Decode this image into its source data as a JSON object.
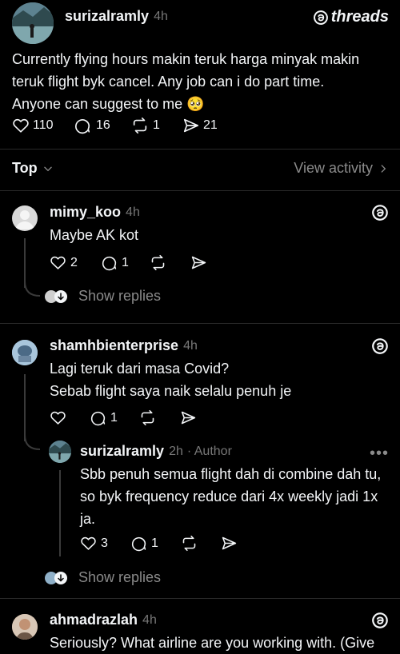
{
  "brand": {
    "name": "threads"
  },
  "post": {
    "username": "surizalramly",
    "time": "4h",
    "text_lines": [
      "Currently flying hours  makin teruk harga minyak  makin",
      "teruk flight byk cancel. Any job can i do part  time.",
      "Anyone  can suggest to me"
    ],
    "emoji": "🥺",
    "likes": "110",
    "comments": "16",
    "reposts": "1",
    "shares": "21"
  },
  "filter": {
    "sort_label": "Top",
    "view_activity": "View activity"
  },
  "replies": [
    {
      "username": "mimy_koo",
      "time": "4h",
      "text_lines": [
        "Maybe AK kot"
      ],
      "likes": "2",
      "comments": "1",
      "show_replies": "Show replies"
    },
    {
      "username": "shamhbienterprise",
      "time": "4h",
      "text_lines": [
        "Lagi teruk dari masa Covid?",
        "Sebab flight saya naik selalu penuh je"
      ],
      "likes": "",
      "comments": "1",
      "nested": {
        "username": "surizalramly",
        "time": "2h",
        "author_tag": "· Author",
        "text_lines": [
          "Sbb penuh semua flight dah di combine dah tu,",
          "so byk frequency reduce dari 4x weekly jadi 1x",
          "ja."
        ],
        "likes": "3",
        "comments": "1"
      },
      "show_replies": "Show replies"
    },
    {
      "username": "ahmadrazlah",
      "time": "4h",
      "text_lines": [
        "Seriously? What airline are you working with. (Give"
      ]
    }
  ],
  "colors": {
    "background": "#000000",
    "text": "#f3f5f7",
    "muted": "#777777",
    "divider": "#2a2a2a"
  }
}
